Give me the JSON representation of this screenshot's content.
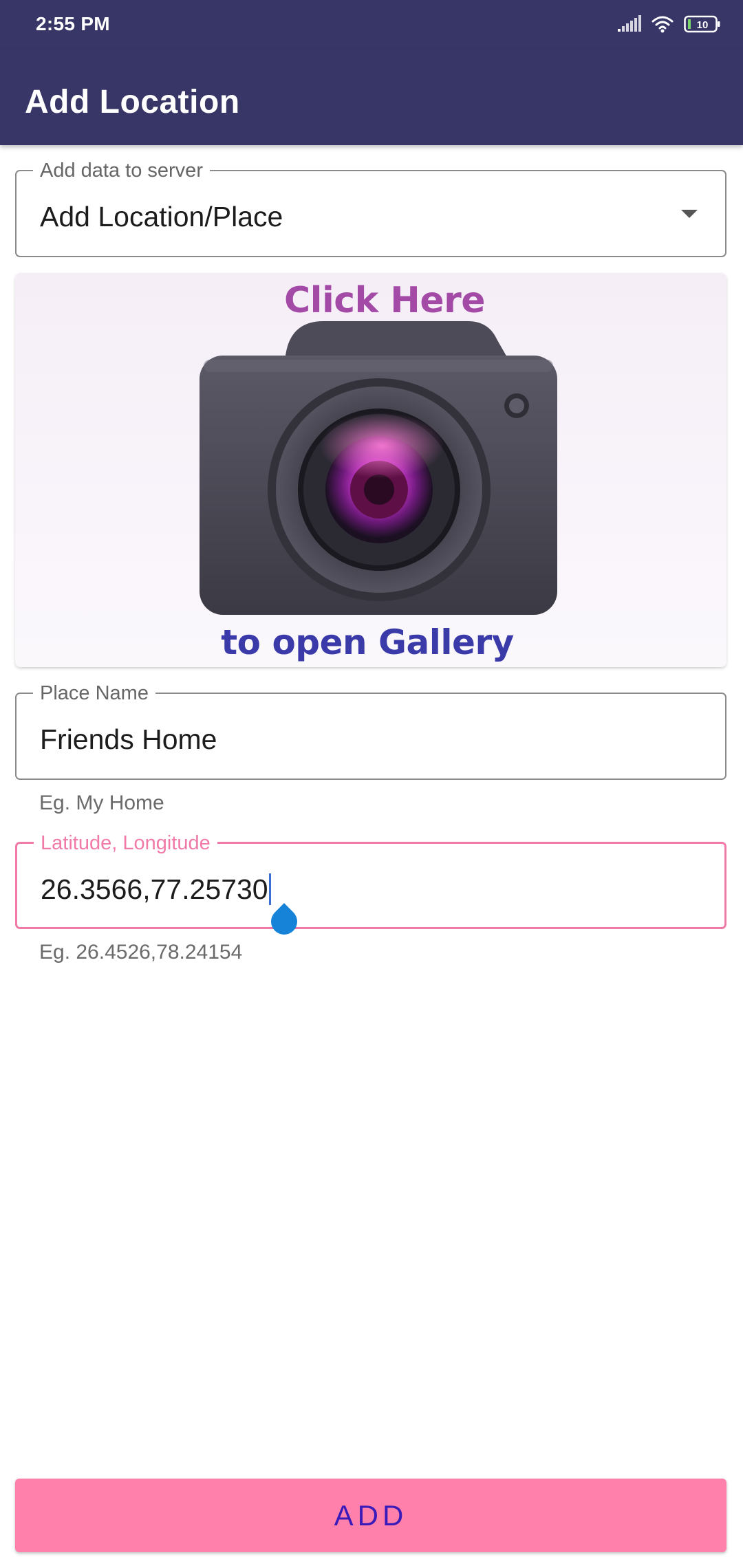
{
  "status_bar": {
    "time": "2:55 PM",
    "battery": "10",
    "icons": [
      "signal-icon",
      "wifi-icon",
      "battery-icon"
    ]
  },
  "app_bar": {
    "title": "Add Location"
  },
  "server_select": {
    "label": "Add data to server",
    "value": "Add Location/Place"
  },
  "image_picker": {
    "top_text": "Click Here",
    "bottom_text": "to open Gallery",
    "icon": "camera-icon"
  },
  "place_name": {
    "label": "Place Name",
    "value": "Friends Home",
    "helper": "Eg. My Home"
  },
  "lat_long": {
    "label": "Latitude, Longitude",
    "value": "26.3566,77.25730",
    "helper": "Eg. 26.4526,78.24154"
  },
  "add_button": {
    "label": "ADD"
  },
  "colors": {
    "app_bar": "#373667",
    "accent_pink": "#ff80ab",
    "focus_pink": "#f07aa8",
    "button_text": "#3a1ab8",
    "click_here_text": "#a24aa6",
    "gallery_text": "#3a3aa8"
  }
}
